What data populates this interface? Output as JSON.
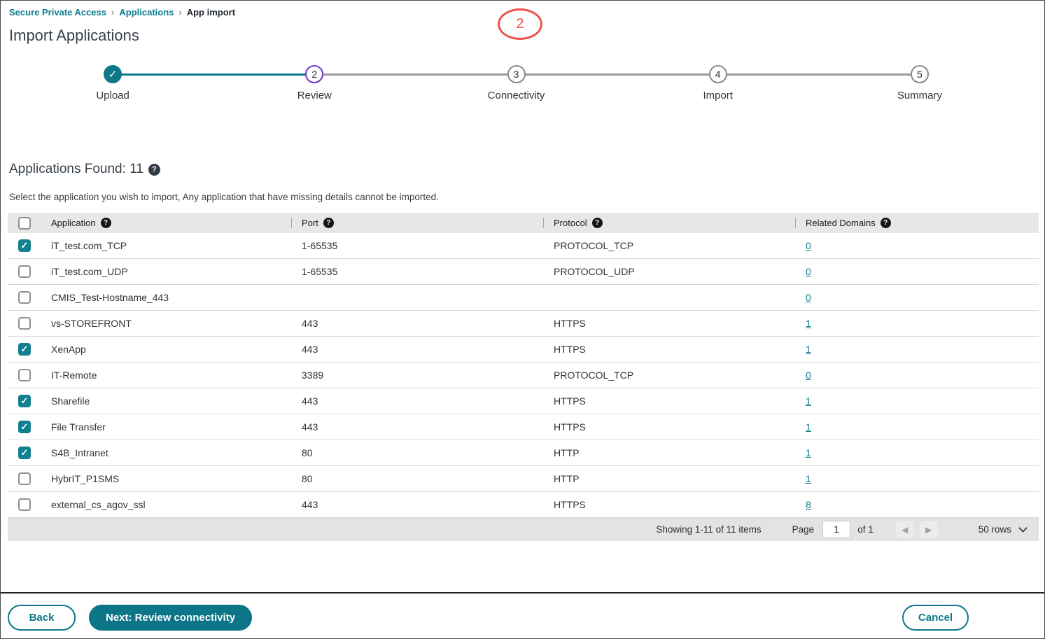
{
  "breadcrumb": {
    "separator": "›",
    "items": [
      {
        "label": "Secure Private Access"
      },
      {
        "label": "Applications"
      },
      {
        "label": "App import"
      }
    ]
  },
  "page": {
    "title": "Import Applications"
  },
  "annotation": {
    "label": "2"
  },
  "icons": {
    "check": "✓",
    "help": "?",
    "prev_arrow": "◀",
    "next_arrow": "▶"
  },
  "stepper": {
    "steps": [
      {
        "label": "Upload",
        "state": "completed",
        "number": "1"
      },
      {
        "label": "Review",
        "state": "active",
        "number": "2"
      },
      {
        "label": "Connectivity",
        "state": "upcoming",
        "number": "3"
      },
      {
        "label": "Import",
        "state": "upcoming",
        "number": "4"
      },
      {
        "label": "Summary",
        "state": "upcoming",
        "number": "5"
      }
    ]
  },
  "section": {
    "heading": "Applications Found: 11",
    "subtext": "Select the application you wish to import, Any application that have missing details cannot be imported."
  },
  "table": {
    "columns": [
      "Application",
      "Port",
      "Protocol",
      "Related Domains"
    ],
    "rows": [
      {
        "checked": true,
        "application": "iT_test.com_TCP",
        "port": "1-65535",
        "protocol": "PROTOCOL_TCP",
        "related_domains": "0"
      },
      {
        "checked": false,
        "application": "iT_test.com_UDP",
        "port": "1-65535",
        "protocol": "PROTOCOL_UDP",
        "related_domains": "0"
      },
      {
        "checked": false,
        "application": "CMIS_Test-Hostname_443",
        "port": "",
        "protocol": "",
        "related_domains": "0"
      },
      {
        "checked": false,
        "application": "vs-STOREFRONT",
        "port": "443",
        "protocol": "HTTPS",
        "related_domains": "1"
      },
      {
        "checked": true,
        "application": "XenApp",
        "port": "443",
        "protocol": "HTTPS",
        "related_domains": "1"
      },
      {
        "checked": false,
        "application": "IT-Remote",
        "port": "3389",
        "protocol": "PROTOCOL_TCP",
        "related_domains": "0"
      },
      {
        "checked": true,
        "application": "Sharefile",
        "port": "443",
        "protocol": "HTTPS",
        "related_domains": "1"
      },
      {
        "checked": true,
        "application": "File Transfer",
        "port": "443",
        "protocol": "HTTPS",
        "related_domains": "1"
      },
      {
        "checked": true,
        "application": "S4B_Intranet",
        "port": "80",
        "protocol": "HTTP",
        "related_domains": "1"
      },
      {
        "checked": false,
        "application": "HybrIT_P1SMS",
        "port": "80",
        "protocol": "HTTP",
        "related_domains": "1"
      },
      {
        "checked": false,
        "application": "external_cs_agov_ssl",
        "port": "443",
        "protocol": "HTTPS",
        "related_domains": "8"
      }
    ]
  },
  "pagination": {
    "showing": "Showing 1-11 of 11 items",
    "page_label": "Page",
    "page_value": "1",
    "of_label": "of 1",
    "rows_label": "50 rows"
  },
  "footer": {
    "back": "Back",
    "next": "Next: Review connectivity",
    "cancel": "Cancel"
  },
  "colors": {
    "teal": "#0b7987",
    "purple": "#7033d5",
    "link": "#0a7d8c",
    "annotation_red": "#ef5350"
  }
}
